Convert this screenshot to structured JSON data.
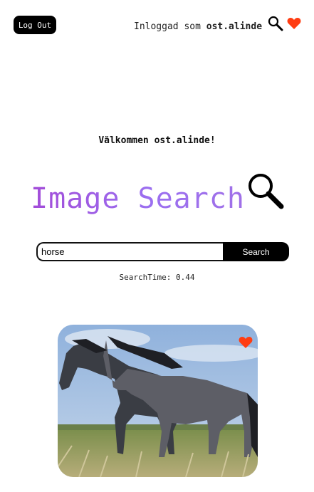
{
  "header": {
    "logout_label": "Log Out",
    "logged_in_prefix": "Inloggad som",
    "username": "ost.alinde",
    "search_icon": "search-icon",
    "favorites_icon": "heart-icon"
  },
  "main": {
    "welcome": "Välkommen ost.alinde!",
    "title": "Image Search",
    "title_icon": "search-icon"
  },
  "search": {
    "query": "horse",
    "button_label": "Search",
    "time_label": "SearchTime:",
    "time_value": "0.44"
  },
  "results": [
    {
      "image": "two dark horses standing in grassland",
      "favorite_icon": "heart-icon"
    }
  ],
  "colors": {
    "accent_heart": "#ff3d12",
    "title_gradient_start": "#a24bd8",
    "title_gradient_end": "#a070e8",
    "button_bg": "#000000"
  }
}
